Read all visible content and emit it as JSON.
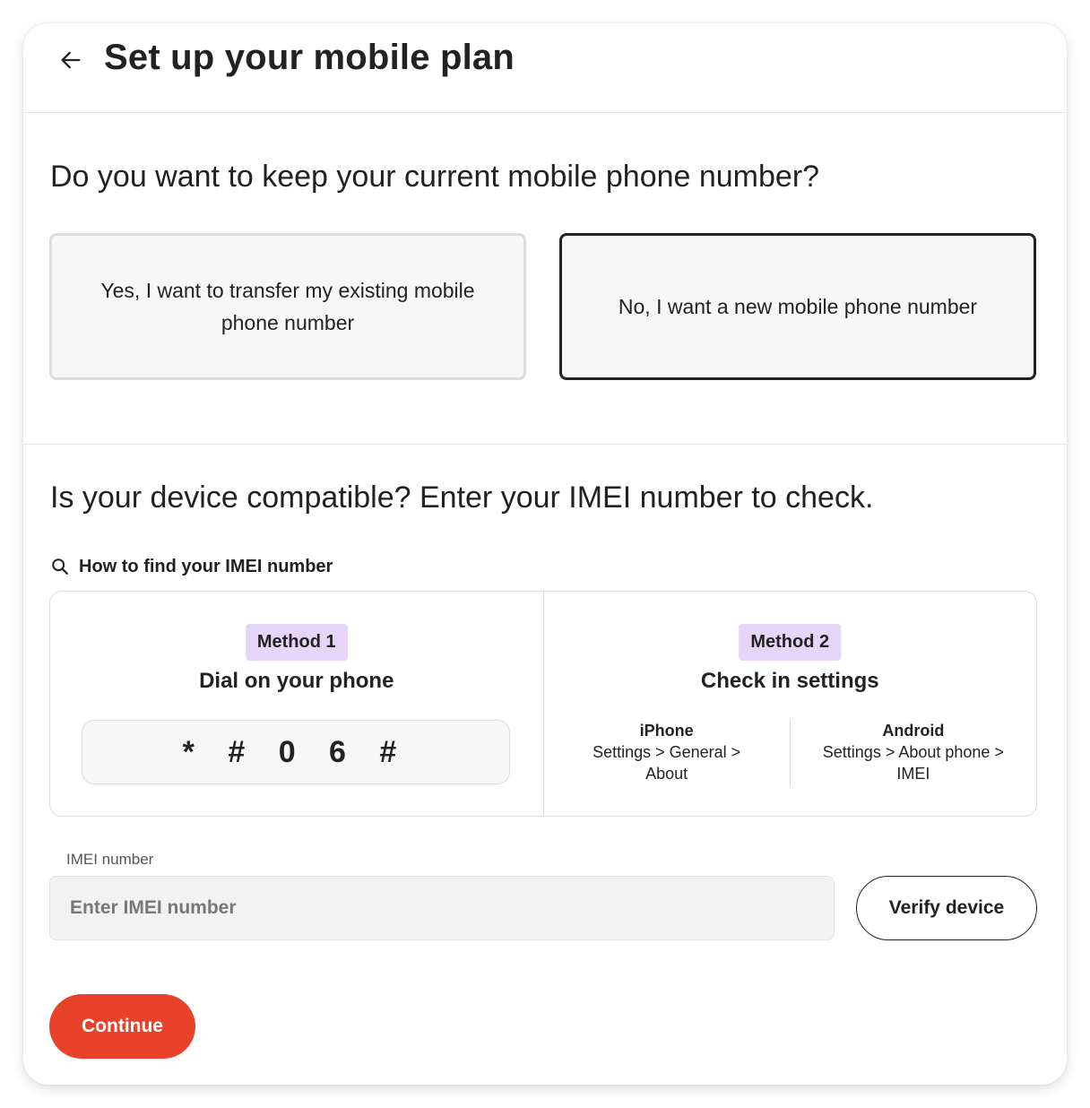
{
  "header": {
    "title": "Set up your mobile plan"
  },
  "number_question": {
    "title": "Do you want to keep your current mobile phone number?",
    "options": [
      {
        "label": "Yes, I want to transfer my existing mobile phone number",
        "selected": false
      },
      {
        "label": "No, I want a new mobile phone number",
        "selected": true
      }
    ]
  },
  "device_section": {
    "title": "Is your device compatible? Enter your IMEI number to check.",
    "how_to": "How to find your IMEI number",
    "method1": {
      "badge": "Method 1",
      "title": "Dial on your phone",
      "code": "* # 0 6 #"
    },
    "method2": {
      "badge": "Method 2",
      "title": "Check in settings",
      "iphone": {
        "name": "iPhone",
        "path": "Settings > General > About"
      },
      "android": {
        "name": "Android",
        "path": "Settings > About phone > IMEI"
      }
    },
    "imei_label": "IMEI number",
    "imei_placeholder": "Enter IMEI number",
    "imei_value": "",
    "verify_label": "Verify device"
  },
  "continue_label": "Continue",
  "colors": {
    "accent": "#e8432a",
    "badge_bg": "#e6d5f8",
    "selected_border": "#222222"
  }
}
